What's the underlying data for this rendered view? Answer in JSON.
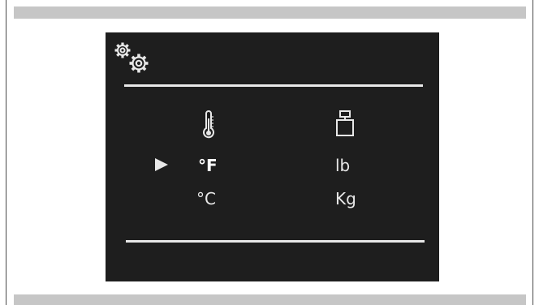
{
  "screen": {
    "title_icon": "settings-gears-icon",
    "columns": [
      {
        "icon": "thermometer-icon",
        "options": [
          {
            "label": "°F",
            "selected": true
          },
          {
            "label": "°C",
            "selected": false
          }
        ]
      },
      {
        "icon": "weight-icon",
        "options": [
          {
            "label": "lb",
            "selected": false
          },
          {
            "label": "Kg",
            "selected": false
          }
        ]
      }
    ],
    "cursor_icon": "play-arrow-icon"
  },
  "colors": {
    "screen_background": "#1e1e1e",
    "foreground": "#e8e8e8",
    "bar": "#c6c6c6"
  }
}
